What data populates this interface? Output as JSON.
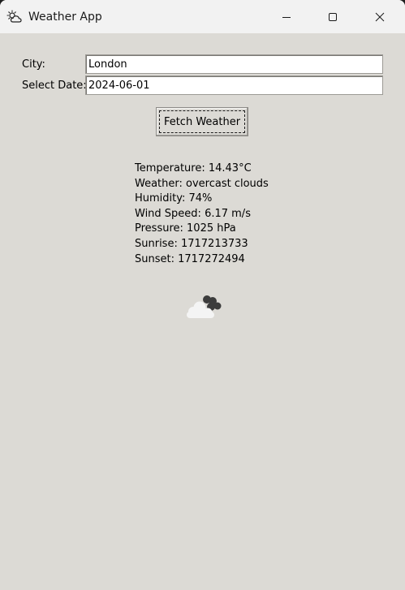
{
  "window": {
    "title": "Weather App",
    "icon": "weather-app-icon"
  },
  "form": {
    "city_label": "City:",
    "city_value": "London",
    "date_label": "Select Date:",
    "date_value": "2024-06-01",
    "fetch_label": "Fetch Weather"
  },
  "weather": {
    "temperature": "Temperature: 14.43°C",
    "description": "Weather: overcast clouds",
    "humidity": "Humidity: 74%",
    "wind_speed": "Wind Speed: 6.17 m/s",
    "pressure": "Pressure: 1025 hPa",
    "sunrise": "Sunrise: 1717213733",
    "sunset": "Sunset: 1717272494",
    "icon": "overcast-clouds-icon"
  },
  "colors": {
    "window_bg": "#dcdad5",
    "titlebar_bg": "#f2f2f2"
  }
}
